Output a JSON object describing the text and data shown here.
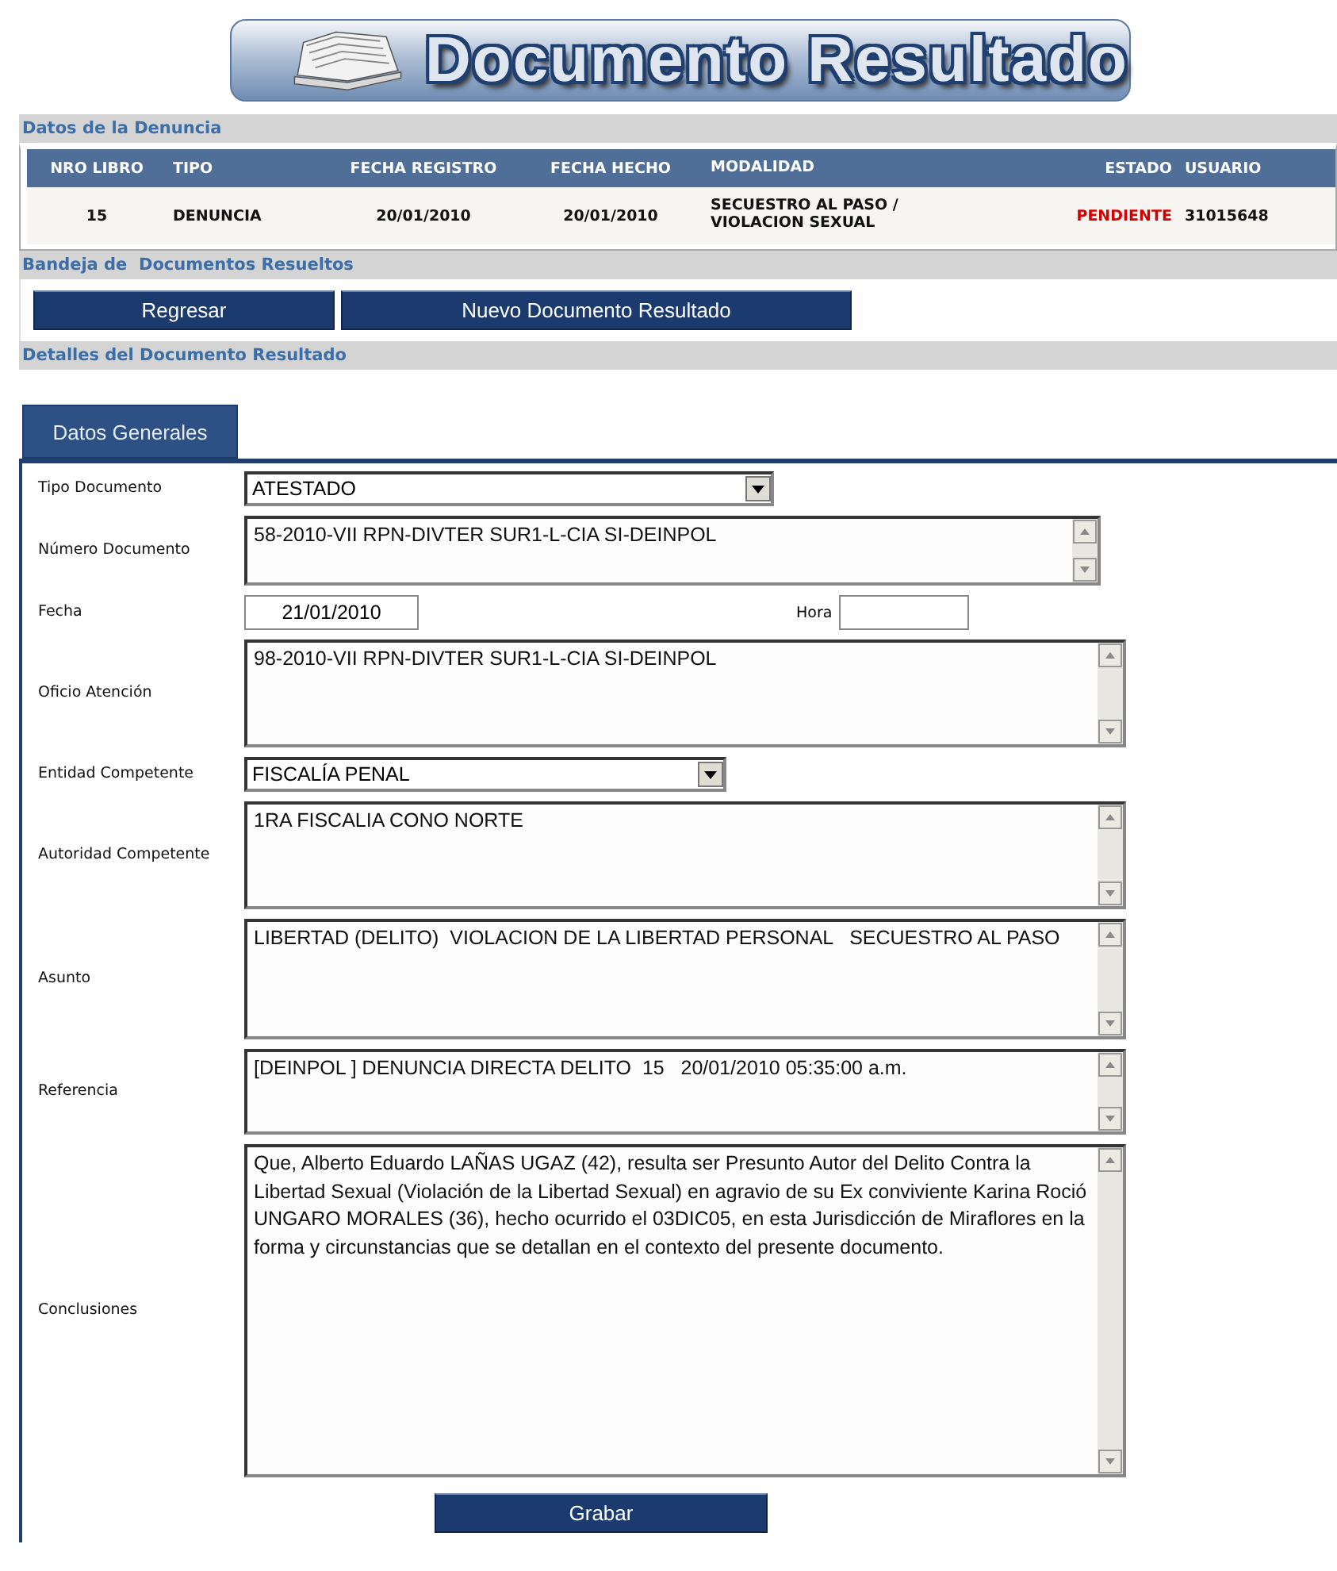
{
  "banner": {
    "title": "Documento Resultado"
  },
  "denuncia": {
    "title": "Datos de la Denuncia",
    "columns": [
      "NRO LIBRO",
      "TIPO",
      "FECHA REGISTRO",
      "FECHA HECHO",
      "MODALIDAD",
      "ESTADO",
      "USUARIO"
    ],
    "row": [
      "15",
      "DENUNCIA",
      "20/01/2010",
      "20/01/2010",
      "SECUESTRO AL PASO / VIOLACION SEXUAL",
      "PENDIENTE",
      "31015648"
    ]
  },
  "bandeja": {
    "title": "Bandeja de  Documentos Resueltos",
    "buttons": [
      "Regresar",
      "Nuevo Documento Resultado"
    ]
  },
  "detalles": {
    "title": "Detalles del Documento Resultado",
    "tabs": [
      {
        "label": "Datos Generales",
        "selected": true
      }
    ],
    "fields": [
      {
        "kind": "select",
        "label": "Tipo Documento",
        "value": "ATESTADO"
      },
      {
        "kind": "textarea",
        "label": "Número Documento",
        "value": "58-2010-VII RPN-DIVTER SUR1-L-CIA SI-DEINPOL"
      },
      {
        "kind": "datetime",
        "label": "Fecha",
        "value": "21/01/2010",
        "time_label": "Hora"
      },
      {
        "kind": "textarea",
        "label": "Oficio Atención",
        "value": "98-2010-VII RPN-DIVTER SUR1-L-CIA SI-DEINPOL"
      },
      {
        "kind": "select",
        "label": "Entidad Competente",
        "value": "FISCALÍA PENAL"
      },
      {
        "kind": "textarea",
        "label": "Autoridad Competente",
        "value": "1RA FISCALIA CONO NORTE"
      },
      {
        "kind": "textarea",
        "label": "Asunto",
        "value": "LIBERTAD (DELITO)  VIOLACION DE LA LIBERTAD PERSONAL   SECUESTRO AL PASO"
      },
      {
        "kind": "textarea",
        "label": "Referencia",
        "value": "[DEINPOL ] DENUNCIA DIRECTA DELITO  15   20/01/2010 05:35:00 a.m."
      },
      {
        "kind": "textarea",
        "label": "Conclusiones",
        "value": "Que, Alberto Eduardo LAÑAS UGAZ (42), resulta ser Presunto Autor del Delito Contra la Libertad Sexual (Violación de la Libertad Sexual) en agravio de su Ex conviviente Karina Roció UNGARO MORALES (36), hecho ocurrido el 03DIC05, en esta Jurisdicción de Miraflores en la forma y circunstancias que se detallan en el contexto del presente documento."
      }
    ],
    "save_button": "Grabar"
  }
}
